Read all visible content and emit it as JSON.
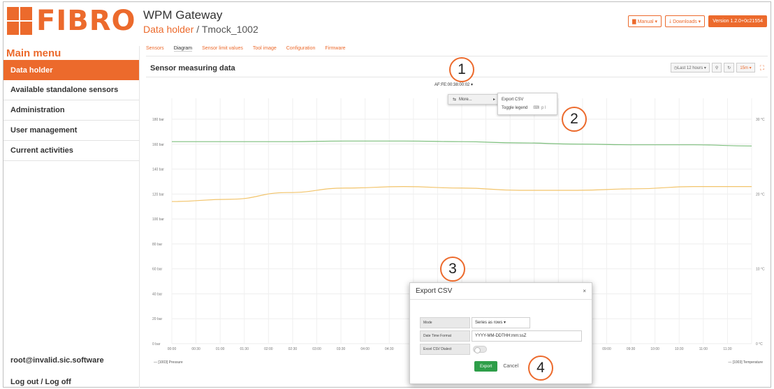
{
  "header": {
    "logo_text": "FIBRO",
    "app_title": "WPM Gateway",
    "breadcrumb_link": "Data holder",
    "breadcrumb_sep": " / ",
    "breadcrumb_current": "Tmock_1002",
    "buttons": {
      "manual": "Manual ▾",
      "downloads": "Downloads ▾",
      "version": "Version 1.2.0+0c21554"
    }
  },
  "tabs": [
    "Sensors",
    "Diagram",
    "Sensor limit values",
    "Tool image",
    "Configuration",
    "Firmware"
  ],
  "sidebar": {
    "title": "Main menu",
    "items": [
      "Data holder",
      "Available standalone sensors",
      "Administration",
      "User management",
      "Current activities"
    ],
    "user": "root@invalid.sic.software",
    "logout": "Log out / Log off"
  },
  "panel": {
    "title": "Sensor measuring data",
    "range": "Last 12 hours ▾",
    "refresh": "15m ▾"
  },
  "chart_menu": {
    "device": "AF:FE:00:38:00:02 ▾",
    "more": "More...",
    "export_csv": "Export CSV",
    "toggle_legend": "Toggle legend",
    "shortcut": "p l"
  },
  "callouts": [
    "1",
    "2",
    "3",
    "4"
  ],
  "modal": {
    "title": "Export CSV",
    "close": "×",
    "mode_label": "Mode",
    "mode_value": "Series as rows ▾",
    "datetime_label": "Date Time Format",
    "datetime_value": "YYYY-MM-DDTHH:mm:ssZ",
    "excel_label": "Excel CSV Dialect",
    "export_button": "Export",
    "cancel_button": "Cancel"
  },
  "colors": {
    "accent": "#ec6a2c",
    "pressure": "#7dbf7d",
    "temperature": "#f2c46b",
    "export": "#2e9e49"
  },
  "chart_data": {
    "type": "line",
    "y_left_ticks": [
      "180 bar",
      "160 bar",
      "140 bar",
      "120 bar",
      "100 bar",
      "80 bar",
      "60 bar",
      "40 bar",
      "20 bar",
      "0 bar"
    ],
    "y_right_ticks": [
      "30 °C",
      "20 °C",
      "10 °C",
      "0 °C"
    ],
    "x_ticks": [
      "00:00",
      "00:30",
      "01:00",
      "01:30",
      "02:00",
      "02:30",
      "03:00",
      "03:30",
      "04:00",
      "04:30",
      "09:00",
      "09:30",
      "10:00",
      "10:30",
      "11:00",
      "11:30"
    ],
    "ylim_left": [
      0,
      180
    ],
    "ylim_right": [
      0,
      30
    ],
    "series": [
      {
        "name": "[1003] Pressure",
        "axis": "left",
        "x": [
          0,
          0.1,
          0.2,
          0.3,
          0.4,
          0.5,
          0.6,
          0.7,
          0.8,
          0.9,
          1.0
        ],
        "values": [
          162,
          162,
          162,
          162.5,
          162.5,
          162,
          161,
          160,
          159.5,
          159.5,
          158.5
        ]
      },
      {
        "name": "[1003] Temperature",
        "axis": "right",
        "x": [
          0,
          0.1,
          0.2,
          0.3,
          0.4,
          0.5,
          0.6,
          0.7,
          0.8,
          0.9,
          1.0
        ],
        "values": [
          19,
          19.3,
          20.2,
          20.8,
          21,
          20.8,
          20.5,
          20.5,
          20.7,
          21,
          21
        ]
      }
    ],
    "grid": true,
    "legend": "bottom"
  }
}
